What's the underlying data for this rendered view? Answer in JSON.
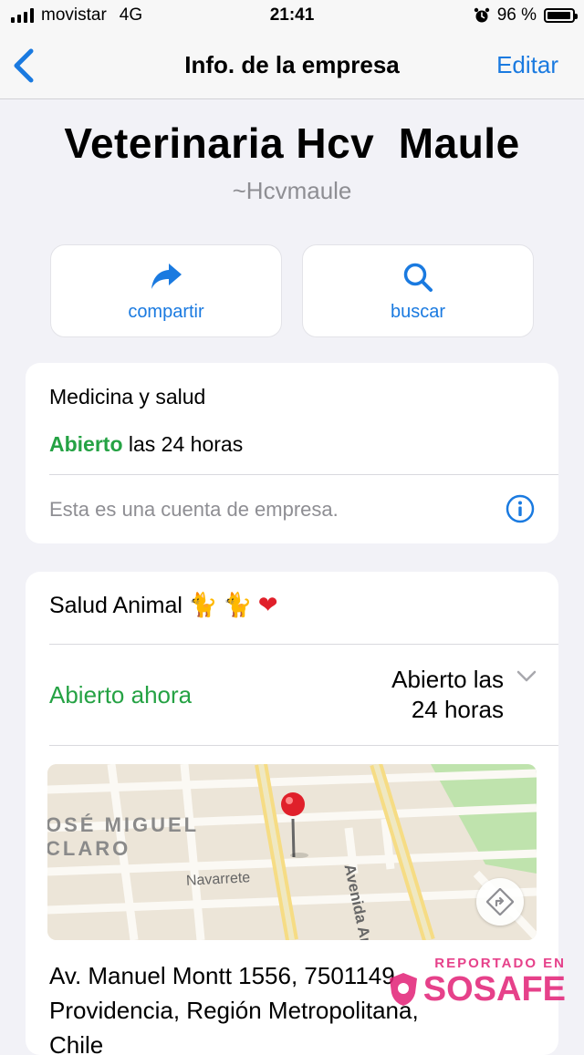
{
  "status_bar": {
    "carrier": "movistar",
    "network": "4G",
    "time": "21:41",
    "battery": "96 %",
    "battery_level": 0.96
  },
  "nav": {
    "back_icon": "chevron-left-icon",
    "title": "Info. de la empresa",
    "edit_label": "Editar"
  },
  "business": {
    "name": "Veterinaria Hcv  Maule",
    "handle": "~Hcvmaule"
  },
  "actions": [
    {
      "label": "compartir",
      "icon": "share-arrow-icon"
    },
    {
      "label": "buscar",
      "icon": "search-icon"
    }
  ],
  "info_card": {
    "category": "Medicina y salud",
    "open_word": "Abierto",
    "hours_text": " las 24 horas",
    "business_note": "Esta es una cuenta de empresa."
  },
  "detail_card": {
    "description": "Salud Animal",
    "emojis": [
      "🐈",
      "🐈",
      "❤"
    ],
    "open_now": "Abierto ahora",
    "hours_line1": "Abierto las",
    "hours_line2": "24 horas",
    "map": {
      "place_line1": "OSÉ MIGUEL",
      "place_line2": "CLARO",
      "street_1": "Navarrete",
      "street_2": "Avenida Anto"
    },
    "address_line1": "Av. Manuel Montt 1556, 7501149",
    "address_line2": "Providencia, Región Metropolitana,",
    "address_line3": "Chile"
  },
  "watermark": {
    "top": "REPORTADO EN",
    "brand": "SOSAFE"
  },
  "colors": {
    "accent": "#1a7ae0",
    "open_green": "#25a244",
    "background": "#f2f2f7",
    "watermark": "#e22076"
  }
}
